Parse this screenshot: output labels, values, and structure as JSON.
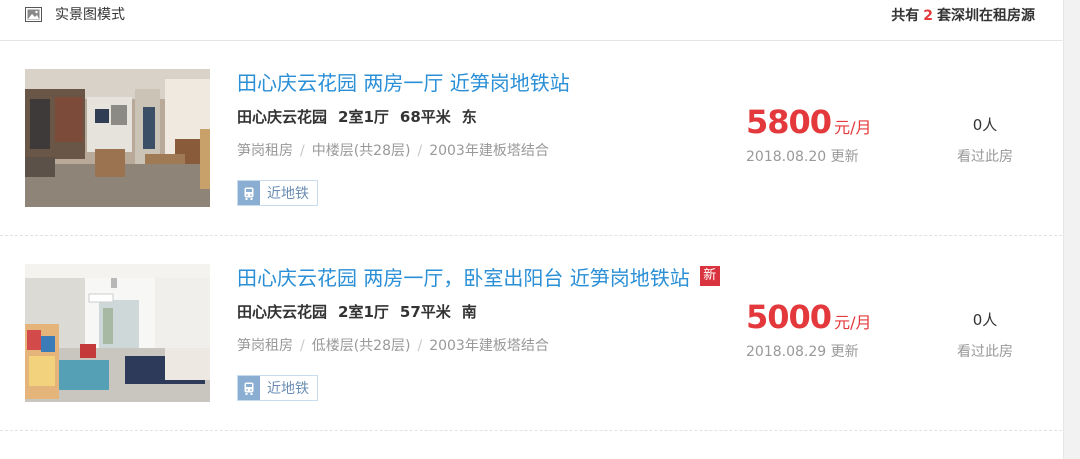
{
  "header": {
    "mode_label": "实景图模式",
    "mode_icon": "picture-icon",
    "count_prefix": "共有",
    "count_value": "2",
    "count_suffix": "套深圳在租房源"
  },
  "listings": [
    {
      "title": "田心庆云花园 两房一厅 近笋岗地铁站",
      "is_new": false,
      "specs": [
        "田心庆云花园",
        "2室1厅",
        "68平米",
        "东"
      ],
      "meta": [
        "笋岗租房",
        "中楼层(共28层)",
        "2003年建板塔结合"
      ],
      "tag": {
        "label": "近地铁",
        "icon": "subway-icon"
      },
      "price": {
        "amount": "5800",
        "unit": "元/月"
      },
      "updated": "2018.08.20 更新",
      "views": {
        "count": "0人",
        "label": "看过此房"
      }
    },
    {
      "title": "田心庆云花园 两房一厅，卧室出阳台 近笋岗地铁站",
      "is_new": true,
      "new_badge": "新",
      "specs": [
        "田心庆云花园",
        "2室1厅",
        "57平米",
        "南"
      ],
      "meta": [
        "笋岗租房",
        "低楼层(共28层)",
        "2003年建板塔结合"
      ],
      "tag": {
        "label": "近地铁",
        "icon": "subway-icon"
      },
      "price": {
        "amount": "5000",
        "unit": "元/月"
      },
      "updated": "2018.08.29 更新",
      "views": {
        "count": "0人",
        "label": "看过此房"
      }
    }
  ],
  "colors": {
    "title_blue": "#2a8fd6",
    "price_red": "#e4393c",
    "new_badge_red": "#d9333f",
    "tag_blue": "#8aaed1",
    "muted_gray": "#999999"
  }
}
